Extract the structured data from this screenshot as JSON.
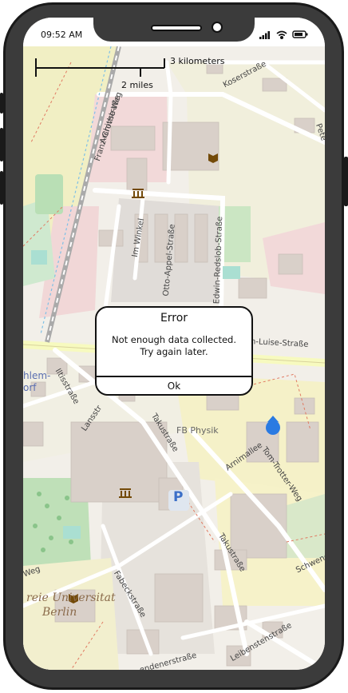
{
  "status_bar": {
    "time": "09:52 AM"
  },
  "map": {
    "scale": {
      "metric": "3 kilometers",
      "imperial": "2 miles"
    },
    "street_labels": {
      "koserstrasse": "Koserstraße",
      "franz_grothe_weg": "Franz-Grothe-Weg",
      "archivstrasse": "Archivstraße",
      "im_winkel": "Im Winkel",
      "otto_appel_strasse": "Otto-Appel-Straße",
      "edwin_redslob_strasse": "Edwin-Redslob-Straße",
      "luise_strasse": "n-Luise-Straße",
      "iltisstrasse": "Iltisstraße",
      "landstrasse": "Lansstr",
      "takustrasse_1": "Takustraße",
      "takustrasse_2": "Takustraße",
      "arnimallee": "Arnimallee",
      "von_trotter_weg": "Tom-Trotter-Weg",
      "fabeckstrasse": "Fabeckstraße",
      "schwendener": "Schwende",
      "weg": "Weg",
      "leiberstrasse": "Leibenstenstraße",
      "endener": "endenerstraße",
      "dahlem": "hlem-",
      "dorf": "orf",
      "petersallee": "Pete"
    },
    "poi_labels": {
      "fb_physik": "FB Physik",
      "parking": "P"
    },
    "university_label_line1": "reie Universitat",
    "university_label_line2": "Berlin"
  },
  "dialog": {
    "title": "Error",
    "message_line1": "Not enough data collected.",
    "message_line2": "Try again later.",
    "button_label": "Ok"
  }
}
